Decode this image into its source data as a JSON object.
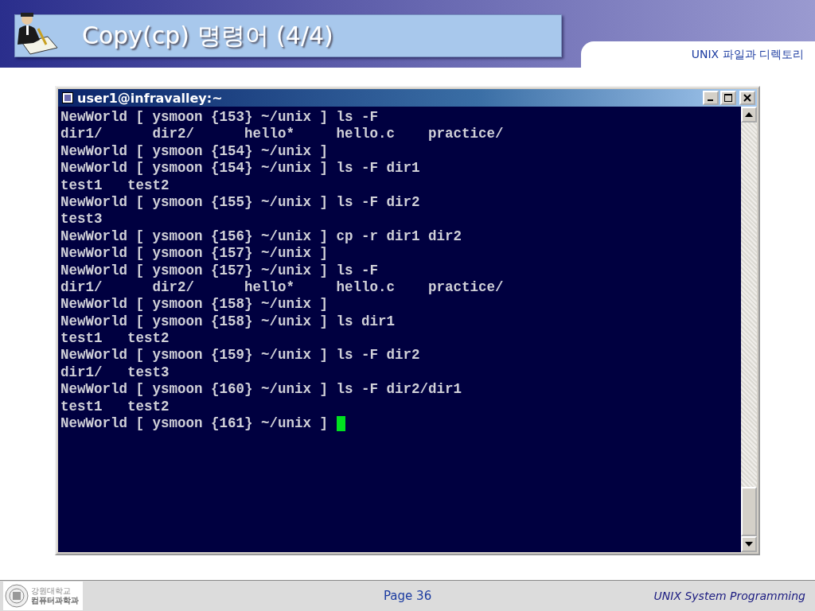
{
  "slide": {
    "title": "Copy(cp) 명령어 (4/4)",
    "section": "UNIX 파일과 디렉토리"
  },
  "terminal": {
    "title": "user1@infravalley:~",
    "lines": [
      "NewWorld [ ysmoon {153} ~/unix ] ls -F",
      "dir1/      dir2/      hello*     hello.c    practice/",
      "NewWorld [ ysmoon {154} ~/unix ]",
      "NewWorld [ ysmoon {154} ~/unix ] ls -F dir1",
      "test1   test2",
      "NewWorld [ ysmoon {155} ~/unix ] ls -F dir2",
      "test3",
      "NewWorld [ ysmoon {156} ~/unix ] cp -r dir1 dir2",
      "NewWorld [ ysmoon {157} ~/unix ]",
      "NewWorld [ ysmoon {157} ~/unix ] ls -F",
      "dir1/      dir2/      hello*     hello.c    practice/",
      "NewWorld [ ysmoon {158} ~/unix ]",
      "NewWorld [ ysmoon {158} ~/unix ] ls dir1",
      "test1   test2",
      "NewWorld [ ysmoon {159} ~/unix ] ls -F dir2",
      "dir1/   test3",
      "NewWorld [ ysmoon {160} ~/unix ] ls -F dir2/dir1",
      "test1   test2",
      "NewWorld [ ysmoon {161} ~/unix ] "
    ]
  },
  "footer": {
    "logo_lines": [
      "강원대학교",
      "컴퓨터과학과"
    ],
    "page": "Page 36",
    "course": "UNIX System Programming"
  }
}
